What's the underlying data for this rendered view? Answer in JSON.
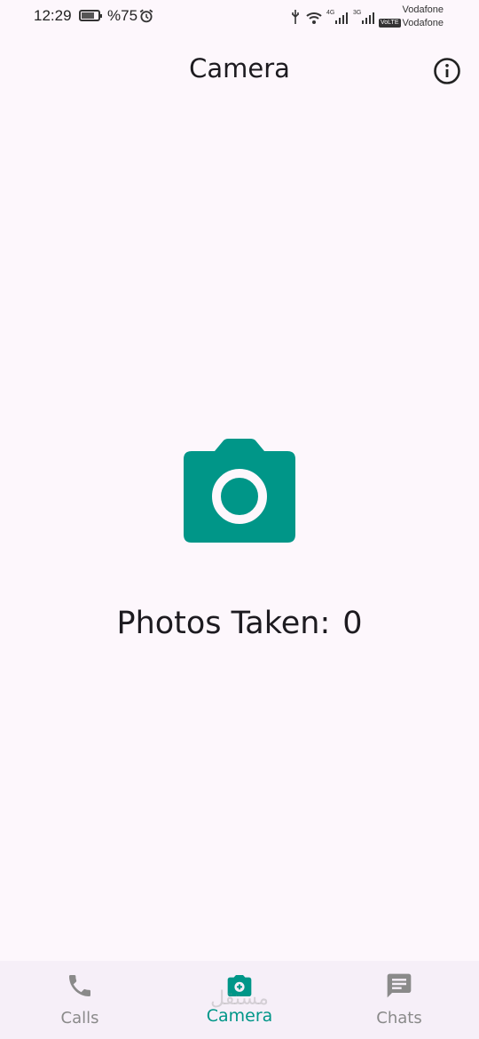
{
  "status_bar": {
    "time": "12:29",
    "battery_percent": "%75",
    "battery_level": 0.75,
    "network_1": "4G",
    "network_2": "3G",
    "carrier_1": "Vodafone",
    "carrier_2": "Vodafone",
    "volte_label": "VoLTE"
  },
  "app_bar": {
    "title": "Camera",
    "info_icon": "info-icon"
  },
  "main": {
    "camera_icon": "camera-icon",
    "photos_label": "Photos Taken:",
    "photos_count": "0"
  },
  "bottom_nav": {
    "items": [
      {
        "label": "Calls",
        "icon": "phone-icon",
        "active": false
      },
      {
        "label": "Camera",
        "icon": "camera-icon",
        "active": true
      },
      {
        "label": "Chats",
        "icon": "chat-icon",
        "active": false
      }
    ],
    "watermark": "مستقل"
  },
  "colors": {
    "accent": "#009688",
    "background": "#fdf7fc",
    "nav_background": "#f6eff8",
    "inactive": "#8a8a8a"
  }
}
